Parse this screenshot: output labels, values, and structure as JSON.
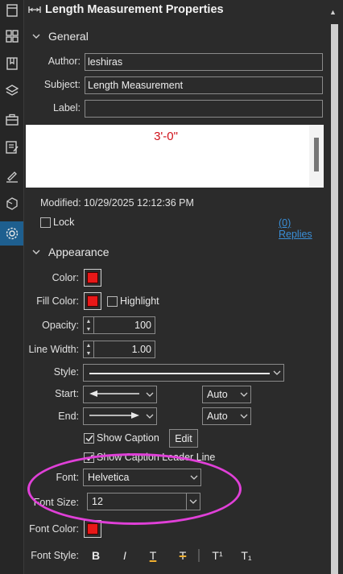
{
  "rail": {
    "icons": [
      "file-icon",
      "grid-icon",
      "bookmark-icon",
      "layers-icon",
      "toolbox-icon",
      "markup-list-icon",
      "signature-icon",
      "tag-icon",
      "settings-icon"
    ],
    "active": "settings-icon"
  },
  "header": {
    "title": "Length Measurement Properties"
  },
  "general": {
    "title": "General",
    "author_label": "Author:",
    "author_value": "leshiras",
    "subject_label": "Subject:",
    "subject_value": "Length Measurement",
    "label_label": "Label:",
    "label_value": "",
    "preview_text": "3'-0\"",
    "modified_label": "Modified:",
    "modified_value": "10/29/2025 12:12:36 PM",
    "lock_label": "Lock",
    "replies_link": "(0) Replies"
  },
  "appearance": {
    "title": "Appearance",
    "color_label": "Color:",
    "fill_color_label": "Fill Color:",
    "highlight_label": "Highlight",
    "opacity_label": "Opacity:",
    "opacity_value": "100",
    "line_width_label": "Line Width:",
    "line_width_value": "1.00",
    "style_label": "Style:",
    "start_label": "Start:",
    "start_auto": "Auto",
    "end_label": "End:",
    "end_auto": "Auto",
    "show_caption_label": "Show Caption",
    "edit_button": "Edit",
    "show_caption_leader_label": "Show Caption Leader Line",
    "font_label": "Font:",
    "font_value": "Helvetica",
    "font_size_label": "Font Size:",
    "font_size_value": "12",
    "font_color_label": "Font Color:",
    "font_style_label": "Font Style:",
    "font_style_buttons": [
      "B",
      "I",
      "T",
      "T",
      "T¹",
      "T₁"
    ]
  },
  "colors": {
    "accent": "#1e5f8f",
    "swatch_red": "#e81818",
    "preview_text": "#d0121b",
    "annotation": "#e040d8",
    "link": "#3a8fd8"
  }
}
